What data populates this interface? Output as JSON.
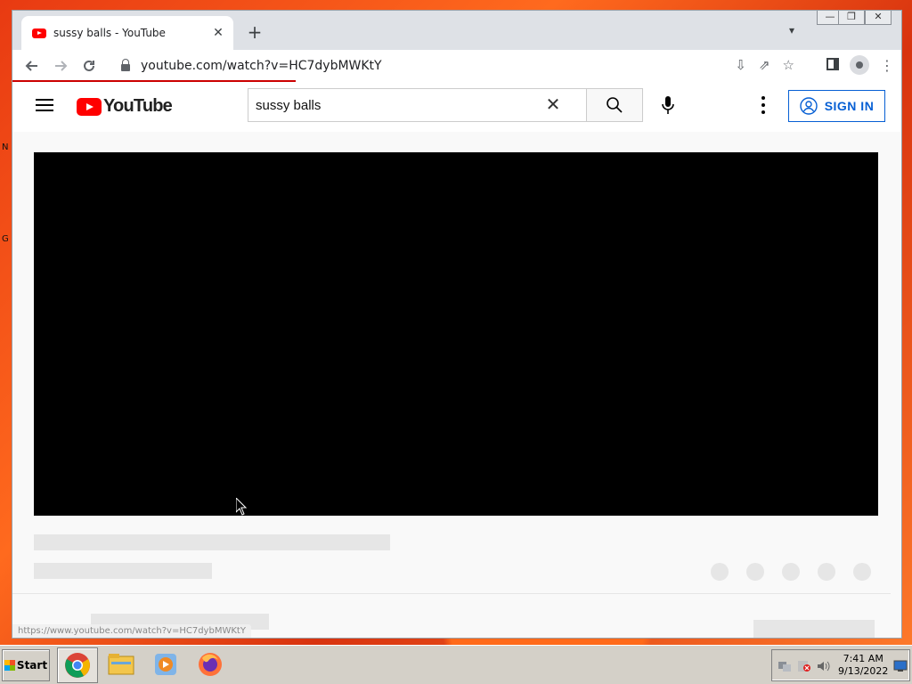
{
  "desktop": {
    "labels": [
      "N",
      "G"
    ]
  },
  "browser": {
    "tab": {
      "title": "sussy balls - YouTube",
      "close": "✕"
    },
    "new_tab": "+",
    "window_controls": {
      "minimize": "—",
      "restore": "❐",
      "close": "✕"
    },
    "url": "youtube.com/watch?v=HC7dybMWKtY",
    "status_url": "https://www.youtube.com/watch?v=HC7dybMWKtY"
  },
  "youtube": {
    "logo_text": "YouTube",
    "search_value": "sussy balls",
    "sign_in_label": "SIGN IN"
  },
  "taskbar": {
    "start_label": "Start",
    "time": "7:41 AM",
    "date": "9/13/2022"
  },
  "colors": {
    "youtube_red": "#ff0000",
    "sign_in_blue": "#065fd4",
    "loading_bar": "#cc0000"
  }
}
